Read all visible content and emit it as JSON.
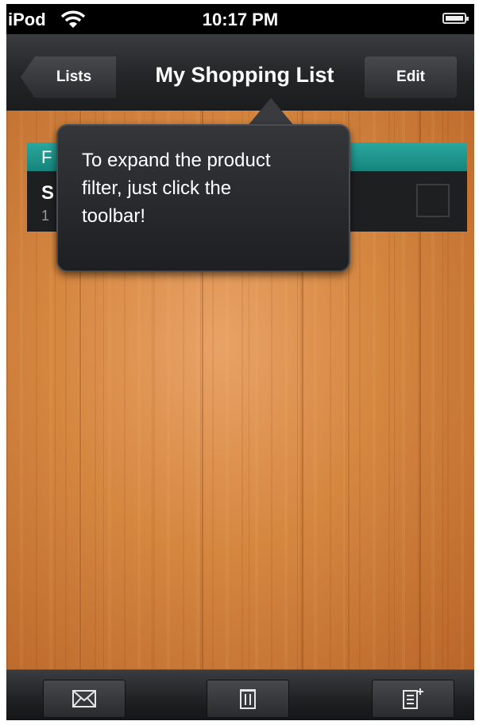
{
  "status_bar": {
    "carrier": "iPod",
    "time": "10:17 PM"
  },
  "nav_bar": {
    "back_label": "Lists",
    "title": "My Shopping List",
    "edit_label": "Edit"
  },
  "list": {
    "section_header": "F",
    "rows": [
      {
        "title": "S",
        "subtitle": "1",
        "checked": false
      }
    ]
  },
  "popover": {
    "text_lines": [
      "To expand the product",
      "filter, just click the",
      "toolbar!"
    ]
  },
  "toolbar": {
    "icons": [
      "mail-icon",
      "trash-icon",
      "add-list-icon"
    ]
  },
  "colors": {
    "section_header": "#1e9990",
    "nav_bar": "#232527",
    "wood": "#d58740"
  }
}
